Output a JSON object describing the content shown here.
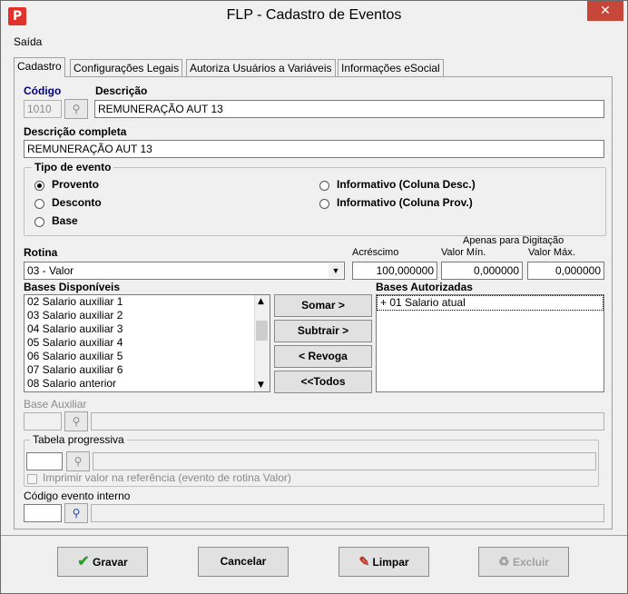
{
  "window": {
    "title": "FLP - Cadastro de Eventos",
    "close_glyph": "✕",
    "app_icon": "P"
  },
  "menu": {
    "saida": "Saída"
  },
  "tabs": [
    "Cadastro",
    "Configurações Legais",
    "Autoriza Usuários a Variáveis",
    "Informações eSocial"
  ],
  "form": {
    "codigo_label": "Código",
    "codigo_value": "1010",
    "descricao_label": "Descrição",
    "descricao_value": "REMUNERAÇÃO AUT 13",
    "descricao_completa_label": "Descrição completa",
    "descricao_completa_value": "REMUNERAÇÃO AUT 13",
    "tipo_evento": {
      "title": "Tipo de evento",
      "options": [
        "Provento",
        "Desconto",
        "Base",
        "Informativo (Coluna Desc.)",
        "Informativo (Coluna Prov.)"
      ],
      "selected": "Provento"
    },
    "rotina_label": "Rotina",
    "rotina_value": "03 - Valor",
    "acrescimo_label": "Acréscimo",
    "acrescimo_value": "100,000000",
    "apenas_label": "Apenas para Digitação",
    "valor_min_label": "Valor Mín.",
    "valor_min_value": "0,000000",
    "valor_max_label": "Valor Máx.",
    "valor_max_value": "0,000000",
    "bases_disponiveis_label": "Bases Disponíveis",
    "bases_disponiveis": [
      "02 Salario auxiliar 1",
      "03 Salario auxiliar 2",
      "04 Salario auxiliar 3",
      "05 Salario auxiliar 4",
      "06 Salario auxiliar 5",
      "07 Salario auxiliar 6",
      "08 Salario anterior"
    ],
    "bases_autorizadas_label": "Bases Autorizadas",
    "bases_autorizadas": [
      "+ 01 Salario atual"
    ],
    "somar": "Somar >",
    "subtrair": "Subtrair >",
    "revoga": "< Revoga",
    "todos": "<<Todos",
    "base_auxiliar_label": "Base Auxiliar",
    "tabela_progressiva_label": "Tabela progressiva",
    "imprimir_label": "Imprimir valor na referência (evento de rotina Valor)",
    "codigo_interno_label": "Código evento interno"
  },
  "buttons": {
    "gravar": "Gravar",
    "cancelar": "Cancelar",
    "limpar": "Limpar",
    "excluir": "Excluir"
  }
}
